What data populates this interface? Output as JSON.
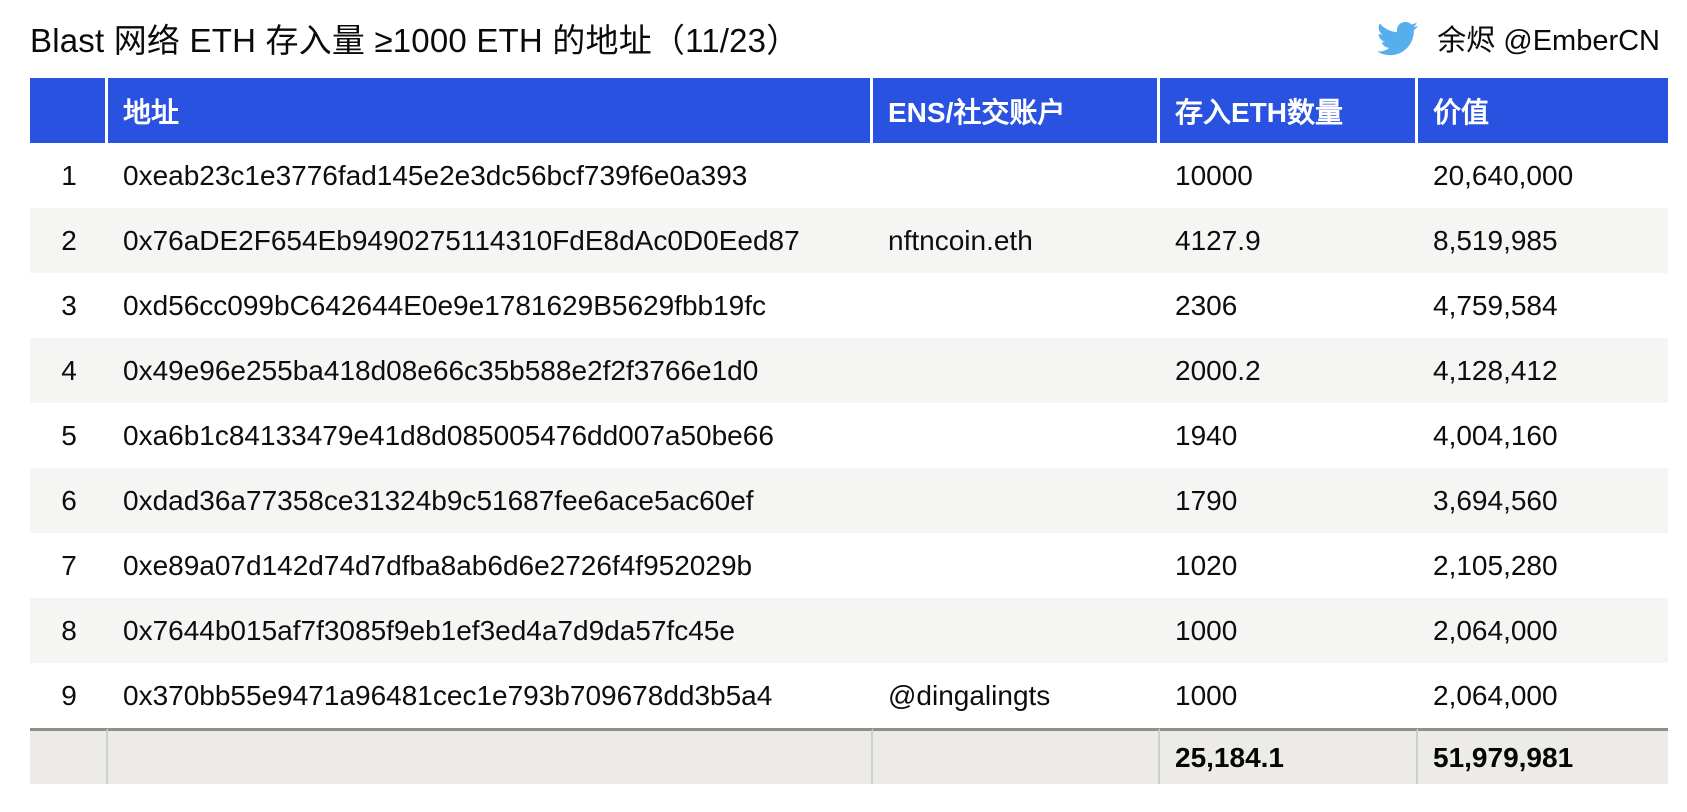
{
  "title": "Blast 网络 ETH 存入量 ≥1000 ETH 的地址（11/23）",
  "attribution": {
    "icon": "twitter-icon",
    "handle": "余烬 @EmberCN"
  },
  "colors": {
    "header_bg": "#2A52E0",
    "twitter_blue": "#57AEEC",
    "row_alt_bg": "#F5F5F3",
    "footer_bg": "#ECEBE8",
    "footer_border": "#8E8E8B",
    "text": "#0D0D0D"
  },
  "table": {
    "columns": [
      "",
      "地址",
      "ENS/社交账户",
      "存入ETH数量",
      "价值"
    ],
    "rows": [
      [
        "1",
        "0xeab23c1e3776fad145e2e3dc56bcf739f6e0a393",
        "",
        "10000",
        "20,640,000"
      ],
      [
        "2",
        "0x76aDE2F654Eb9490275114310FdE8dAc0D0Eed87",
        "nftncoin.eth",
        "4127.9",
        "8,519,985"
      ],
      [
        "3",
        "0xd56cc099bC642644E0e9e1781629B5629fbb19fc",
        "",
        "2306",
        "4,759,584"
      ],
      [
        "4",
        "0x49e96e255ba418d08e66c35b588e2f2f3766e1d0",
        "",
        "2000.2",
        "4,128,412"
      ],
      [
        "5",
        "0xa6b1c84133479e41d8d085005476dd007a50be66",
        "",
        "1940",
        "4,004,160"
      ],
      [
        "6",
        "0xdad36a77358ce31324b9c51687fee6ace5ac60ef",
        "",
        "1790",
        "3,694,560"
      ],
      [
        "7",
        "0xe89a07d142d74d7dfba8ab6d6e2726f4f952029b",
        "",
        "1020",
        "2,105,280"
      ],
      [
        "8",
        "0x7644b015af7f3085f9eb1ef3ed4a7d9da57fc45e",
        "",
        "1000",
        "2,064,000"
      ],
      [
        "9",
        "0x370bb55e9471a96481cec1e793b709678dd3b5a4",
        "@dingalingts",
        "1000",
        "2,064,000"
      ]
    ],
    "total": {
      "rank": "",
      "address": "",
      "ens": "",
      "eth": "25,184.1",
      "value": "51,979,981"
    }
  },
  "chart_data": {
    "type": "table",
    "title": "Blast 网络 ETH 存入量 ≥1000 ETH 的地址（11/23）",
    "columns": [
      "#",
      "地址",
      "ENS/社交账户",
      "存入ETH数量",
      "价值"
    ],
    "rows": [
      {
        "rank": 1,
        "address": "0xeab23c1e3776fad145e2e3dc56bcf739f6e0a393",
        "ens": "",
        "eth_deposited": 10000,
        "value_usd": 20640000
      },
      {
        "rank": 2,
        "address": "0x76aDE2F654Eb9490275114310FdE8dAc0D0Eed87",
        "ens": "nftncoin.eth",
        "eth_deposited": 4127.9,
        "value_usd": 8519985
      },
      {
        "rank": 3,
        "address": "0xd56cc099bC642644E0e9e1781629B5629fbb19fc",
        "ens": "",
        "eth_deposited": 2306,
        "value_usd": 4759584
      },
      {
        "rank": 4,
        "address": "0x49e96e255ba418d08e66c35b588e2f2f3766e1d0",
        "ens": "",
        "eth_deposited": 2000.2,
        "value_usd": 4128412
      },
      {
        "rank": 5,
        "address": "0xa6b1c84133479e41d8d085005476dd007a50be66",
        "ens": "",
        "eth_deposited": 1940,
        "value_usd": 4004160
      },
      {
        "rank": 6,
        "address": "0xdad36a77358ce31324b9c51687fee6ace5ac60ef",
        "ens": "",
        "eth_deposited": 1790,
        "value_usd": 3694560
      },
      {
        "rank": 7,
        "address": "0xe89a07d142d74d7dfba8ab6d6e2726f4f952029b",
        "ens": "",
        "eth_deposited": 1020,
        "value_usd": 2105280
      },
      {
        "rank": 8,
        "address": "0x7644b015af7f3085f9eb1ef3ed4a7d9da57fc45e",
        "ens": "",
        "eth_deposited": 1000,
        "value_usd": 2064000
      },
      {
        "rank": 9,
        "address": "0x370bb55e9471a96481cec1e793b709678dd3b5a4",
        "ens": "@dingalingts",
        "eth_deposited": 1000,
        "value_usd": 2064000
      }
    ],
    "totals": {
      "eth_deposited": 25184.1,
      "value_usd": 51979981
    }
  }
}
